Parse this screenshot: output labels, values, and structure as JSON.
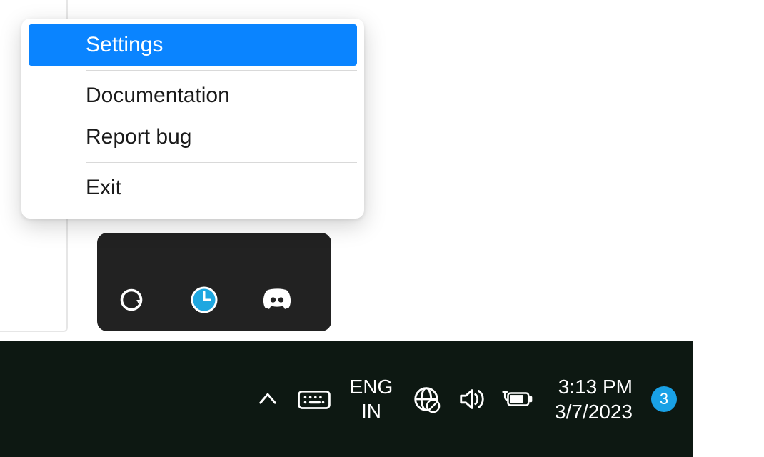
{
  "context_menu": {
    "items": [
      {
        "label": "Settings",
        "highlighted": true
      },
      {
        "label": "Documentation",
        "highlighted": false
      },
      {
        "label": "Report bug",
        "highlighted": false
      },
      {
        "label": "Exit",
        "highlighted": false
      }
    ]
  },
  "tray_flyout": {
    "icons": [
      "grammarly-icon",
      "clock-icon",
      "discord-icon"
    ]
  },
  "taskbar": {
    "language_top": "ENG",
    "language_bottom": "IN",
    "time": "3:13 PM",
    "date": "3/7/2023",
    "notification_count": "3"
  }
}
